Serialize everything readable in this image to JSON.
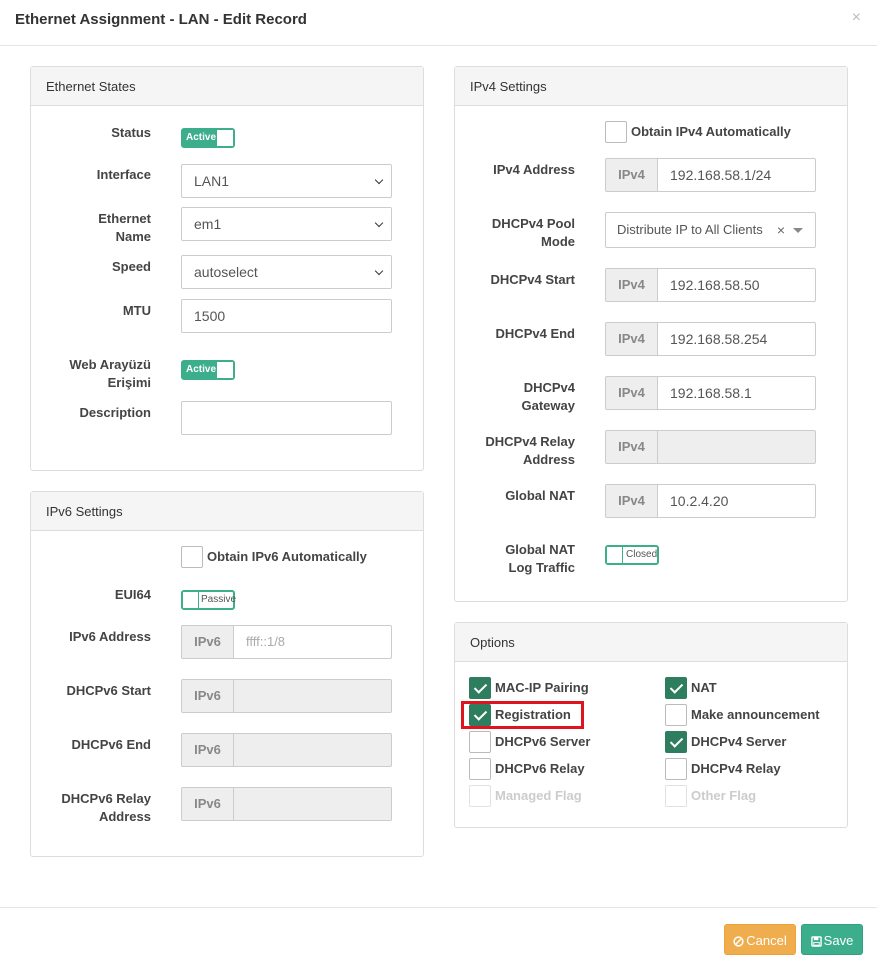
{
  "modal": {
    "title": "Ethernet Assignment - LAN - Edit Record",
    "close_label": "×"
  },
  "ethernet_states": {
    "heading": "Ethernet States",
    "status_label": "Status",
    "status_toggle": "Active",
    "interface_label": "Interface",
    "interface_value": "LAN1",
    "ethernet_name_label_1": "Ethernet",
    "ethernet_name_label_2": "Name",
    "ethernet_name_value": "em1",
    "speed_label": "Speed",
    "speed_value": "autoselect",
    "mtu_label": "MTU",
    "mtu_value": "1500",
    "web_label_1": "Web Arayüzü",
    "web_label_2": "Erişimi",
    "web_toggle": "Active",
    "description_label": "Description",
    "description_value": ""
  },
  "ipv6": {
    "heading": "IPv6 Settings",
    "obtain_label": "Obtain IPv6 Automatically",
    "eui64_label": "EUI64",
    "eui64_toggle": "Passive",
    "address_label": "IPv6 Address",
    "address_addon": "IPv6",
    "address_placeholder": "ffff::1/8",
    "start_label": "DHCPv6 Start",
    "start_addon": "IPv6",
    "end_label": "DHCPv6 End",
    "end_addon": "IPv6",
    "relay_label_1": "DHCPv6 Relay",
    "relay_label_2": "Address",
    "relay_addon": "IPv6"
  },
  "ipv4": {
    "heading": "IPv4 Settings",
    "obtain_label": "Obtain IPv4 Automatically",
    "address_label": "IPv4 Address",
    "address_addon": "IPv4",
    "address_value": "192.168.58.1/24",
    "pool_label_1": "DHCPv4 Pool",
    "pool_label_2": "Mode",
    "pool_value": "Distribute IP to All Clients",
    "pool_clear": "×",
    "start_label": "DHCPv4 Start",
    "start_addon": "IPv4",
    "start_value": "192.168.58.50",
    "end_label": "DHCPv4 End",
    "end_addon": "IPv4",
    "end_value": "192.168.58.254",
    "gateway_label_1": "DHCPv4",
    "gateway_label_2": "Gateway",
    "gateway_addon": "IPv4",
    "gateway_value": "192.168.58.1",
    "relay_label_1": "DHCPv4 Relay",
    "relay_label_2": "Address",
    "relay_addon": "IPv4",
    "nat_label": "Global NAT",
    "nat_addon": "IPv4",
    "nat_value": "10.2.4.20",
    "nat_log_label_1": "Global NAT",
    "nat_log_label_2": "Log Traffic",
    "nat_log_toggle": "Closed"
  },
  "options": {
    "heading": "Options",
    "mac_ip_pairing": "MAC-IP Pairing",
    "nat": "NAT",
    "registration": "Registration",
    "make_announcement": "Make announcement",
    "dhcpv6_server": "DHCPv6 Server",
    "dhcpv4_server": "DHCPv4 Server",
    "dhcpv6_relay": "DHCPv6 Relay",
    "dhcpv4_relay": "DHCPv4 Relay",
    "managed_flag": "Managed Flag",
    "other_flag": "Other Flag"
  },
  "footer": {
    "cancel_label": "Cancel",
    "save_label": "Save"
  },
  "colors": {
    "accent_green": "#3cae8c",
    "checkbox_green": "#2e7d5e",
    "cancel_orange": "#f0ad4e",
    "highlight_red": "#e0141e"
  }
}
